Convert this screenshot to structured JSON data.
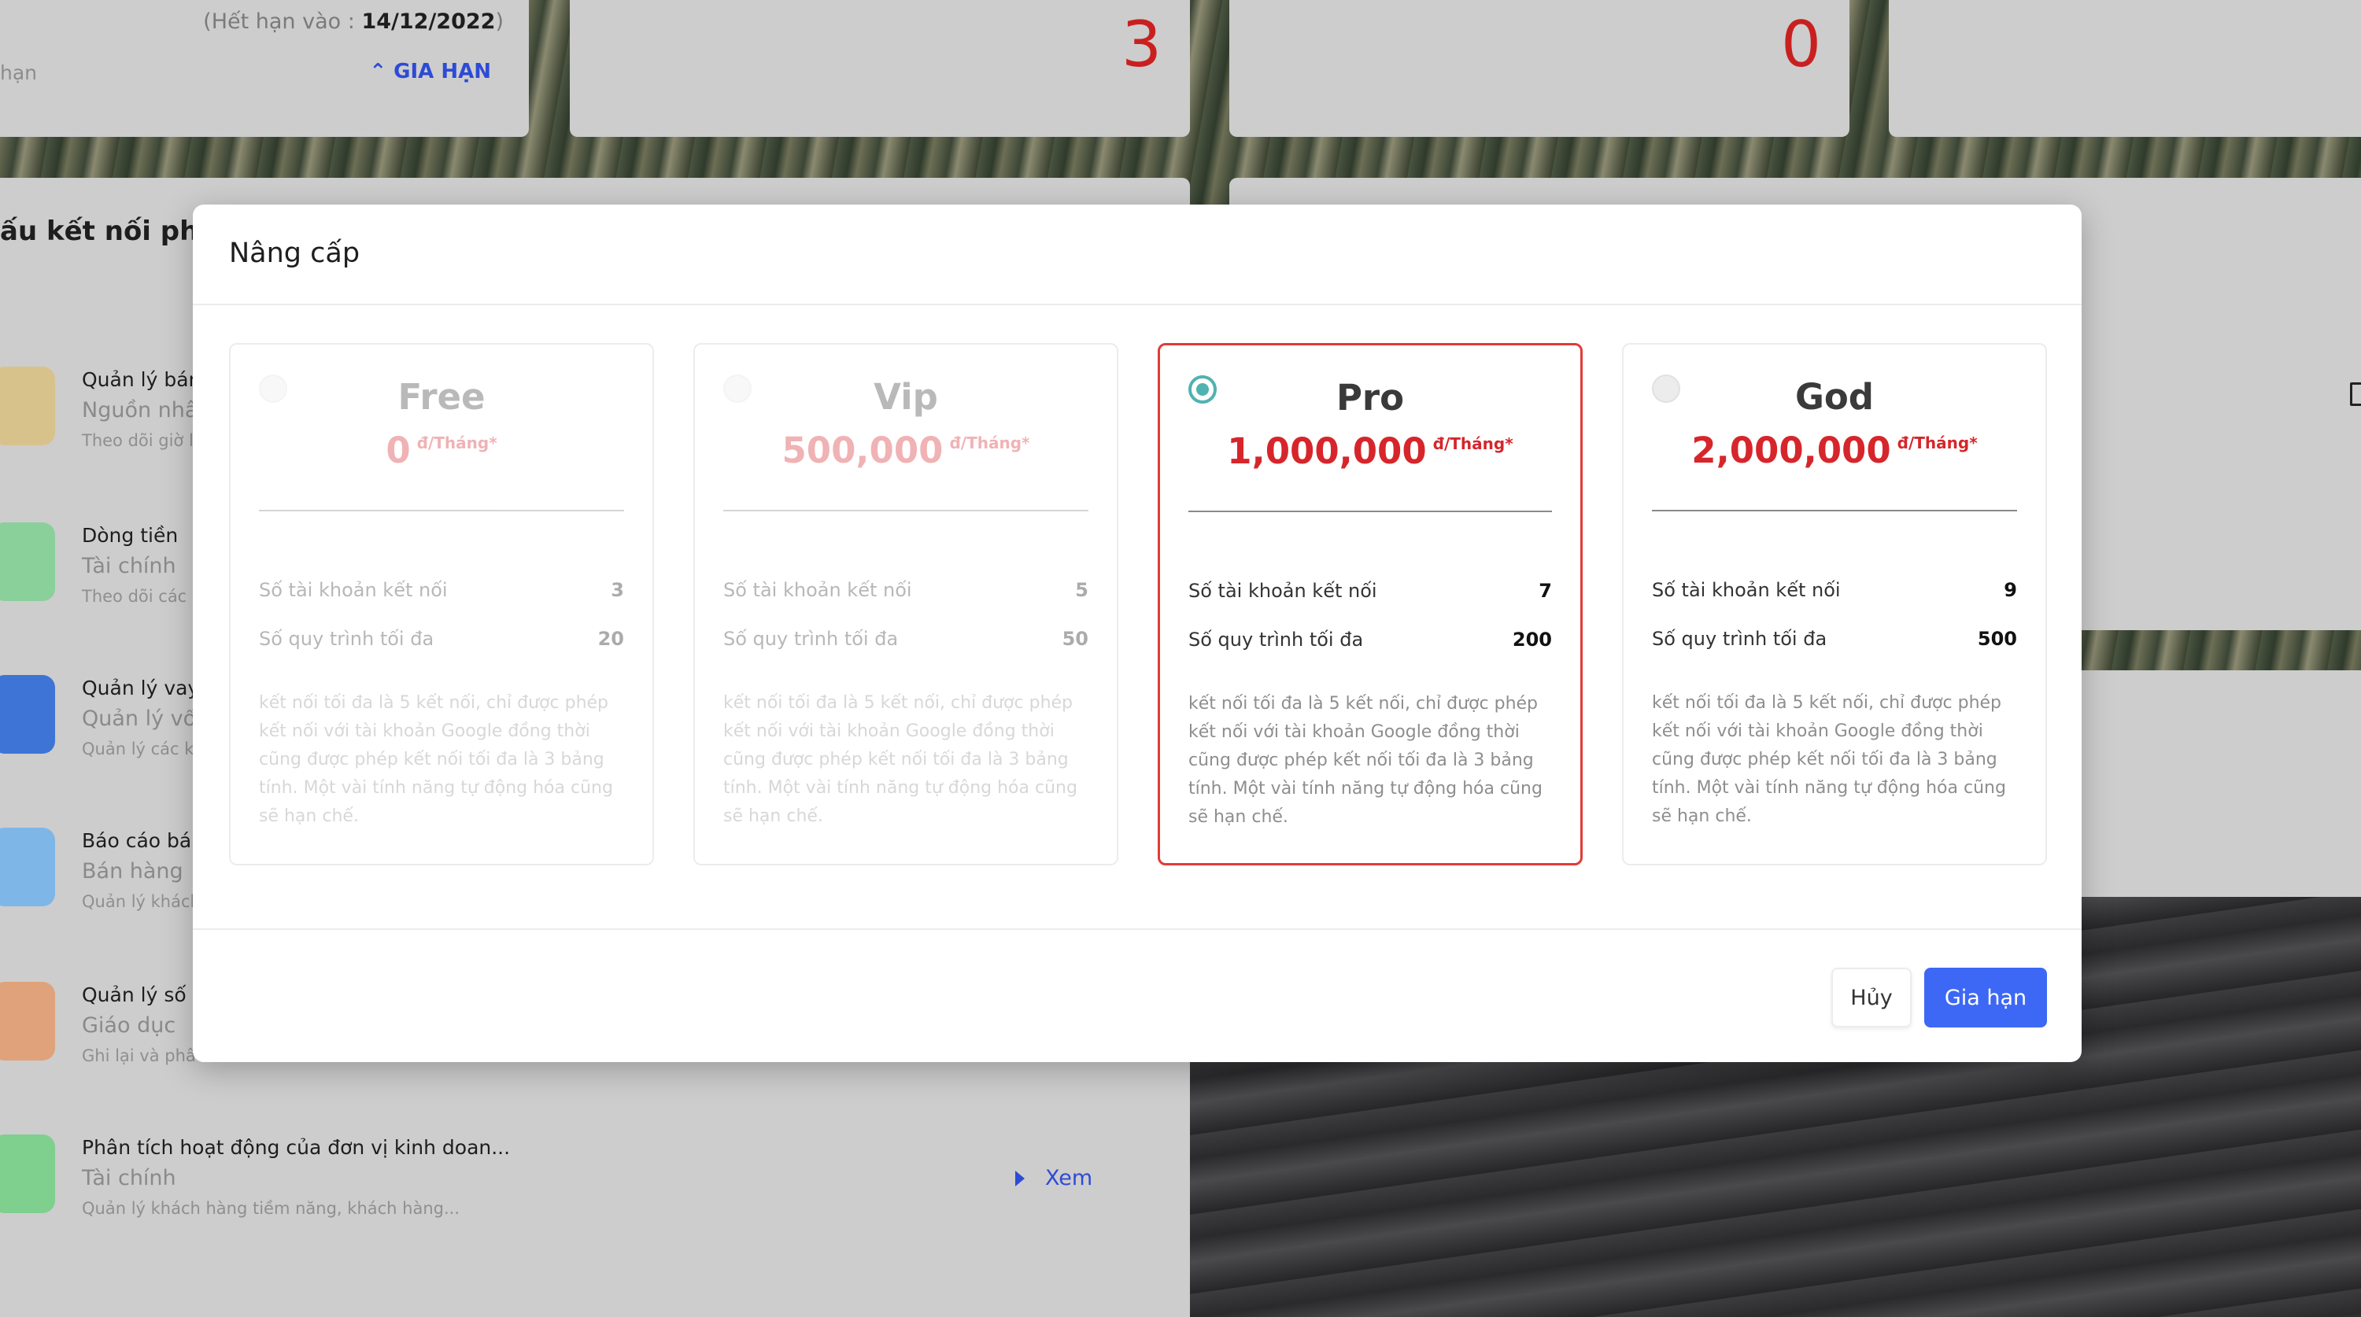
{
  "background": {
    "expire_label": "(Hết hạn vào : ",
    "expire_date": "14/12/2022",
    "expire_close": ")",
    "expire_left_text": "hạn",
    "renew_link": "GIA HẠN",
    "stats": [
      "3",
      "0"
    ],
    "list_title": "ấu kết nối phổ b",
    "items": [
      {
        "name": "Quản lý bán",
        "category": "Nguồn nhâ",
        "desc": "Theo dõi giờ l",
        "color": "#d8c28c"
      },
      {
        "name": "Dòng tiền",
        "category": "Tài chính",
        "desc": "Theo dõi các",
        "color": "#8ad09a"
      },
      {
        "name": "Quản lý vay",
        "category": "Quản lý vố",
        "desc": "Quản lý các k",
        "color": "#3d74d6"
      },
      {
        "name": "Báo cáo bá",
        "category": "Bán hàng",
        "desc": "Quản lý khách",
        "color": "#7fb6e8"
      },
      {
        "name": "Quản lý số đ",
        "category": "Giáo dục",
        "desc": "Ghi lại và phâ",
        "color": "#e0a27a"
      },
      {
        "name": "Phân tích hoạt động của đơn vị kinh doan...",
        "category": "Tài chính",
        "desc": "Quản lý khách hàng tiềm năng, khách hàng...",
        "color": "#7fcf8e",
        "view": "Xem"
      }
    ]
  },
  "modal": {
    "title": "Nâng cấp",
    "plans": [
      {
        "name": "Free",
        "price": "0",
        "unit": "đ/Tháng*",
        "accounts_label": "Số tài khoản kết nối",
        "accounts": "3",
        "workflows_label": "Số quy trình tối đa",
        "workflows": "20",
        "desc": "kết nối tối đa là 5 kết nối, chỉ được phép kết nối với tài khoản Google đồng thời cũng được phép kết nối tối đa là 3 bảng tính. Một vài tính năng tự động hóa cũng sẽ hạn chế.",
        "state": "dim"
      },
      {
        "name": "Vip",
        "price": "500,000",
        "unit": "đ/Tháng*",
        "accounts_label": "Số tài khoản kết nối",
        "accounts": "5",
        "workflows_label": "Số quy trình tối đa",
        "workflows": "50",
        "desc": "kết nối tối đa là 5 kết nối, chỉ được phép kết nối với tài khoản Google đồng thời cũng được phép kết nối tối đa là 3 bảng tính. Một vài tính năng tự động hóa cũng sẽ hạn chế.",
        "state": "dim"
      },
      {
        "name": "Pro",
        "price": "1,000,000",
        "unit": "đ/Tháng*",
        "accounts_label": "Số tài khoản kết nối",
        "accounts": "7",
        "workflows_label": "Số quy trình tối đa",
        "workflows": "200",
        "desc": "kết nối tối đa là 5 kết nối, chỉ được phép kết nối với tài khoản Google đồng thời cũng được phép kết nối tối đa là 3 bảng tính. Một vài tính năng tự động hóa cũng sẽ hạn chế.",
        "state": "selected"
      },
      {
        "name": "God",
        "price": "2,000,000",
        "unit": "đ/Tháng*",
        "accounts_label": "Số tài khoản kết nối",
        "accounts": "9",
        "workflows_label": "Số quy trình tối đa",
        "workflows": "500",
        "desc": "kết nối tối đa là 5 kết nối, chỉ được phép kết nối với tài khoản Google đồng thời cũng được phép kết nối tối đa là 3 bảng tính. Một vài tính năng tự động hóa cũng sẽ hạn chế.",
        "state": "normal"
      }
    ],
    "cancel_label": "Hủy",
    "renew_label": "Gia hạn",
    "colors": {
      "price": "#d6262b",
      "selected_border": "#e23b37",
      "radio_on": "#4fb3b0",
      "primary": "#3d68f5"
    }
  }
}
